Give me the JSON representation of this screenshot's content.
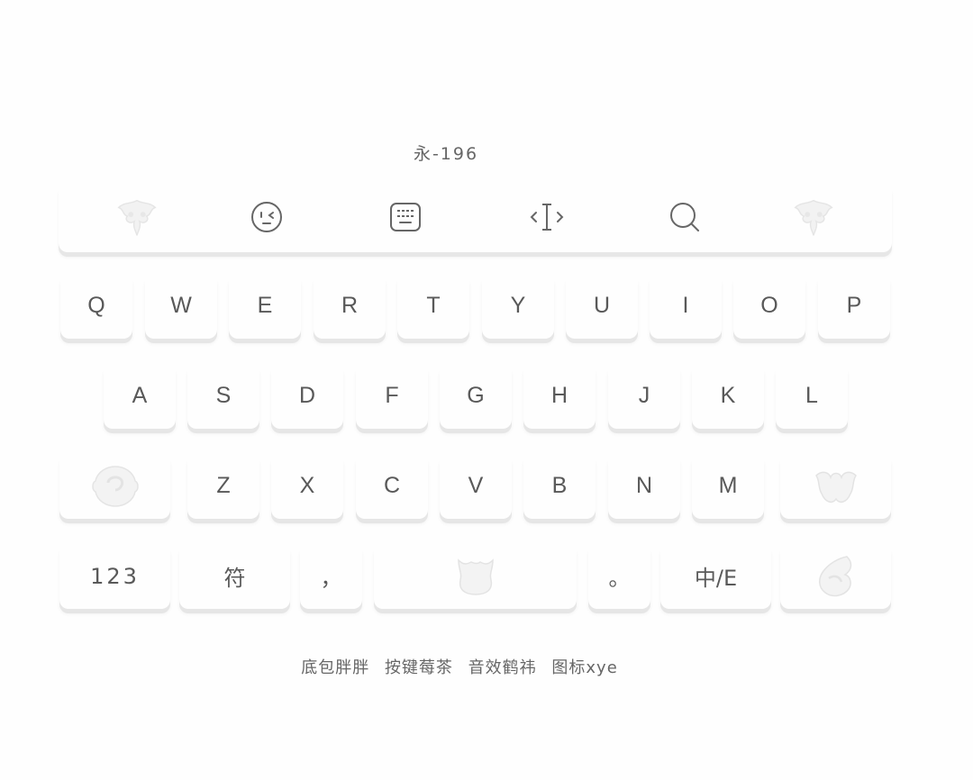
{
  "title": "永-196",
  "toolbar": {
    "items": [
      {
        "name": "left-ornament-icon"
      },
      {
        "name": "emoji-icon"
      },
      {
        "name": "keyboard-icon"
      },
      {
        "name": "cursor-move-icon"
      },
      {
        "name": "search-icon"
      },
      {
        "name": "right-ornament-icon"
      }
    ]
  },
  "keyboard": {
    "row1": [
      "Q",
      "W",
      "E",
      "R",
      "T",
      "Y",
      "U",
      "I",
      "O",
      "P"
    ],
    "row2": [
      "A",
      "S",
      "D",
      "F",
      "G",
      "H",
      "J",
      "K",
      "L"
    ],
    "row3": [
      "Z",
      "X",
      "C",
      "V",
      "B",
      "N",
      "M"
    ],
    "bottom": {
      "numbers": "123",
      "symbols": "符",
      "comma": "，",
      "period": "。",
      "lang_switch": "中/E"
    }
  },
  "footer": {
    "credit1": "底包胖胖",
    "credit2": "按键莓茶",
    "credit3": "音效鹤祎",
    "credit4": "图标xye"
  },
  "colors": {
    "background": "#fefefe",
    "key_shadow": "#e6e6e6",
    "text": "#595959",
    "ornament": "#eeeeee"
  }
}
